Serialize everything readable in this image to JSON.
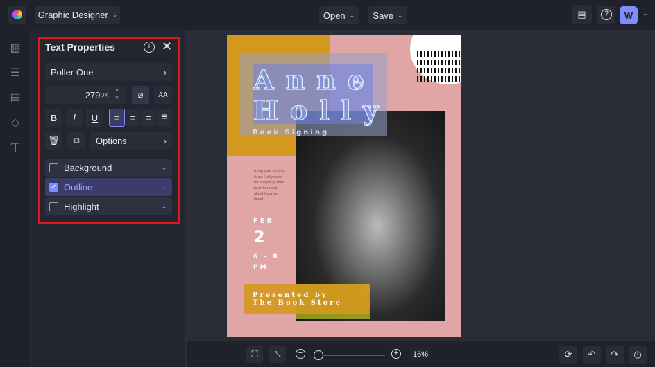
{
  "topbar": {
    "app_mode": "Graphic Designer",
    "open": "Open",
    "save": "Save",
    "avatar": "W"
  },
  "panel": {
    "title": "Text Properties",
    "font": "Poller One",
    "size": "279",
    "unit": "px",
    "bold": "B",
    "italic": "I",
    "underline": "U",
    "options": "Options",
    "sections": [
      {
        "label": "Background",
        "checked": false
      },
      {
        "label": "Outline",
        "checked": true
      },
      {
        "label": "Highlight",
        "checked": false
      }
    ]
  },
  "poster": {
    "title1": "Anne",
    "title2": "Holly",
    "subtitle": "Book Signing",
    "blurb": "Bring your favorite Anne Holly novel for a signing, then hear her read aloud from her latest",
    "month": "FEB",
    "day": "2",
    "time1": "6 - 8",
    "time2": "PM",
    "presented1": "Presented by",
    "presented2": "The Book Store"
  },
  "zoom": {
    "level": "16%",
    "value": 0.05
  },
  "colors": {
    "accent": "#7f8cff",
    "highlight": "#e0161b",
    "pink": "#e0a6a6",
    "mustard": "#d4981f"
  }
}
